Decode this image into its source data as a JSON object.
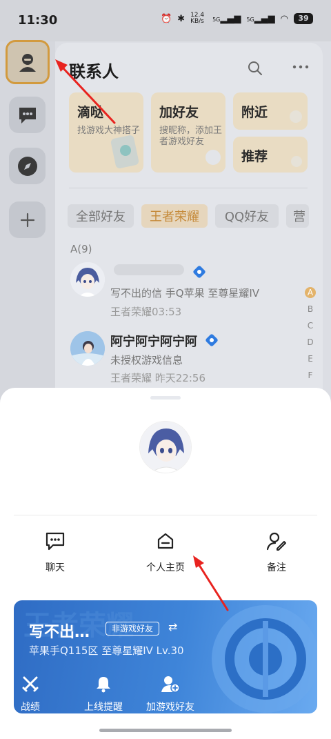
{
  "status_bar": {
    "time": "11:30",
    "network_speed": "12.4 KB/s",
    "signal_1": "5G",
    "signal_2": "5G",
    "battery": "39"
  },
  "header": {
    "title": "联系人"
  },
  "cards": [
    {
      "title": "滴哒",
      "subtitle": "找游戏大神搭子"
    },
    {
      "title": "加好友",
      "subtitle": "搜昵称，添加王者游戏好友"
    },
    {
      "title": "附近"
    },
    {
      "title": "推荐"
    }
  ],
  "tabs": [
    "全部好友",
    "王者荣耀",
    "QQ好友",
    "营"
  ],
  "section_letter": "A(9)",
  "contacts": [
    {
      "name": "",
      "line": "写不出的信 手Q苹果 至尊星耀IV",
      "meta": "王者荣耀03:53"
    },
    {
      "name": "阿宁阿宁阿宁阿",
      "line": "未授权游戏信息",
      "meta": "王者荣耀 昨天22:56"
    }
  ],
  "alphabet": [
    "A",
    "B",
    "C",
    "D",
    "E",
    "F"
  ],
  "sheet": {
    "actions": [
      {
        "label": "聊天",
        "icon": "chat-icon"
      },
      {
        "label": "个人主页",
        "icon": "home-icon"
      },
      {
        "label": "备注",
        "icon": "edit-note-icon"
      }
    ],
    "game_card": {
      "name": "写不出…",
      "badge": "非游戏好友",
      "subtitle": "苹果手Q115区 至尊星耀IV Lv.30",
      "buttons": [
        {
          "label": "战绩",
          "icon": "swords-icon"
        },
        {
          "label": "上线提醒",
          "icon": "bell-icon"
        },
        {
          "label": "加游戏好友",
          "icon": "add-friend-icon"
        }
      ]
    }
  },
  "colors": {
    "accent_gold": "#c58a3a",
    "annotation_arrow": "#e8231f",
    "card_blue": "#3a7fd6",
    "badge_blue": "#2f7be0"
  }
}
